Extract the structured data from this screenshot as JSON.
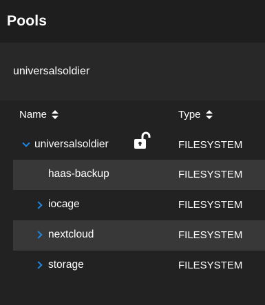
{
  "page": {
    "title": "Pools"
  },
  "pool": {
    "name": "universalsoldier"
  },
  "table": {
    "columns": {
      "name": "Name",
      "type": "Type"
    },
    "rows": [
      {
        "name": "universalsoldier",
        "type": "FILESYSTEM",
        "expander": "chevron-down-icon",
        "lock": "unlocked-padlock-icon"
      },
      {
        "name": "haas-backup",
        "type": "FILESYSTEM",
        "expander": ""
      },
      {
        "name": "iocage",
        "type": "FILESYSTEM",
        "expander": "chevron-right-icon"
      },
      {
        "name": "nextcloud",
        "type": "FILESYSTEM",
        "expander": "chevron-right-icon"
      },
      {
        "name": "storage",
        "type": "FILESYSTEM",
        "expander": "chevron-right-icon"
      }
    ]
  },
  "colors": {
    "accent": "#1e88e5",
    "background": "#1e1e1e",
    "card": "#282828",
    "row_alt": "#383838"
  }
}
